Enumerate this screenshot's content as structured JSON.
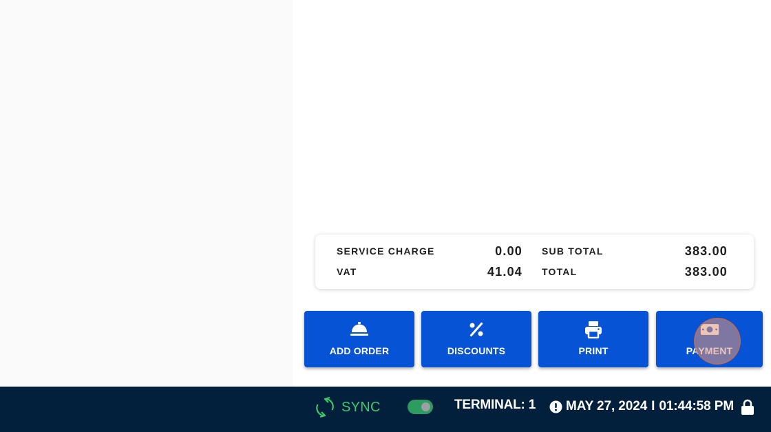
{
  "summary": {
    "service_charge_label": "SERVICE CHARGE",
    "service_charge_value": "0.00",
    "vat_label": "VAT",
    "vat_value": "41.04",
    "sub_total_label": "SUB TOTAL",
    "sub_total_value": "383.00",
    "total_label": "TOTAL",
    "total_value": "383.00"
  },
  "actions": {
    "add_order": {
      "label": "ADD ORDER",
      "icon": "service-bell-icon"
    },
    "discounts": {
      "label": "DISCOUNTS",
      "icon": "percent-icon"
    },
    "print": {
      "label": "PRINT",
      "icon": "printer-icon"
    },
    "payment": {
      "label": "PAYMENT",
      "icon": "cash-icon"
    }
  },
  "status_bar": {
    "sync_label": "SYNC",
    "terminal_label": "TERMINAL: 1",
    "date": "MAY 27, 2024",
    "separator": "I",
    "time": "01:44:58 PM",
    "toggle_on": true
  },
  "colors": {
    "button_blue": "#0753d6",
    "status_bar_bg": "#02203b",
    "sync_green": "#3ec96b",
    "toggle_green": "#2e9b60"
  }
}
